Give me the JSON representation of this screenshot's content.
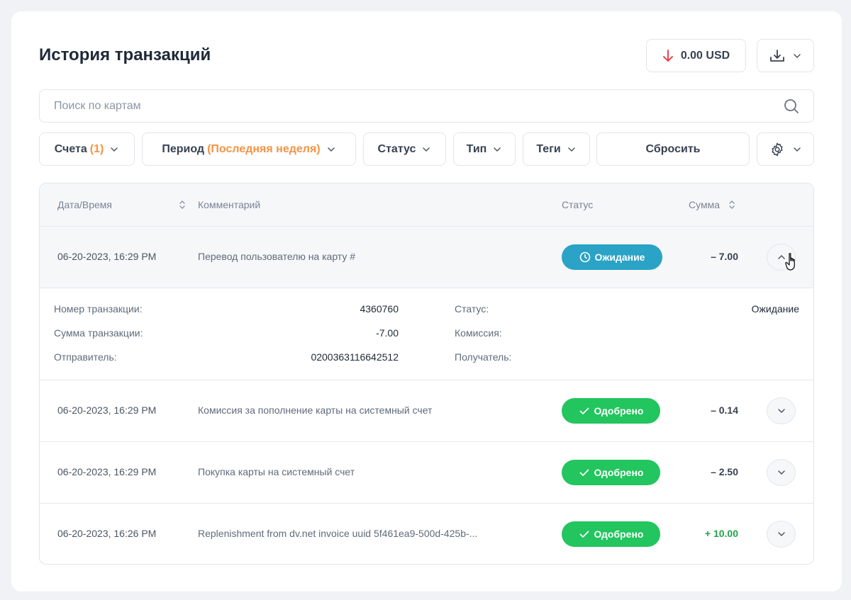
{
  "header": {
    "title": "История транзакций",
    "balance": "0.00 USD"
  },
  "search": {
    "placeholder": "Поиск по картам"
  },
  "filters": {
    "accounts_label": "Счета",
    "accounts_count": "(1)",
    "period_label": "Период",
    "period_value": "(Последняя неделя)",
    "status_label": "Статус",
    "type_label": "Тип",
    "tags_label": "Теги",
    "reset_label": "Сбросить"
  },
  "table": {
    "columns": {
      "datetime": "Дата/Время",
      "comment": "Комментарий",
      "status": "Статус",
      "amount": "Сумма"
    },
    "rows": [
      {
        "datetime": "06-20-2023, 16:29 PM",
        "comment": "Перевод пользователю на карту #",
        "status": "Ожидание",
        "amount": "– 7.00"
      },
      {
        "datetime": "06-20-2023, 16:29 PM",
        "comment": "Комиссия за пополнение карты на системный счет",
        "status": "Одобрено",
        "amount": "– 0.14"
      },
      {
        "datetime": "06-20-2023, 16:29 PM",
        "comment": "Покупка карты на системный счет",
        "status": "Одобрено",
        "amount": "– 2.50"
      },
      {
        "datetime": "06-20-2023, 16:26 PM",
        "comment": "Replenishment from dv.net invoice uuid 5f461ea9-500d-425b-...",
        "status": "Одобрено",
        "amount": "+ 10.00"
      }
    ],
    "details": {
      "tx_number_label": "Номер транзакции:",
      "tx_number": "4360760",
      "tx_amount_label": "Сумма транзакции:",
      "tx_amount": "-7.00",
      "sender_label": "Отправитель:",
      "sender": "0200363116642512",
      "status_label": "Статус:",
      "status": "Ожидание",
      "fee_label": "Комиссия:",
      "recipient_label": "Получатель:"
    }
  },
  "colors": {
    "accent_orange": "#f59344",
    "pending_blue": "#2aa3c6",
    "approved_green": "#22c55e",
    "negative_red": "#e5484d",
    "positive_green": "#22a34a"
  },
  "icons": {
    "balance": "arrow-down-icon",
    "download": "download-icon",
    "search": "search-icon",
    "settings": "gear-icon",
    "sort": "sort-icon",
    "pending": "clock-icon",
    "approved": "check-icon",
    "expand": "chevron-down-icon",
    "collapse": "chevron-up-icon"
  }
}
